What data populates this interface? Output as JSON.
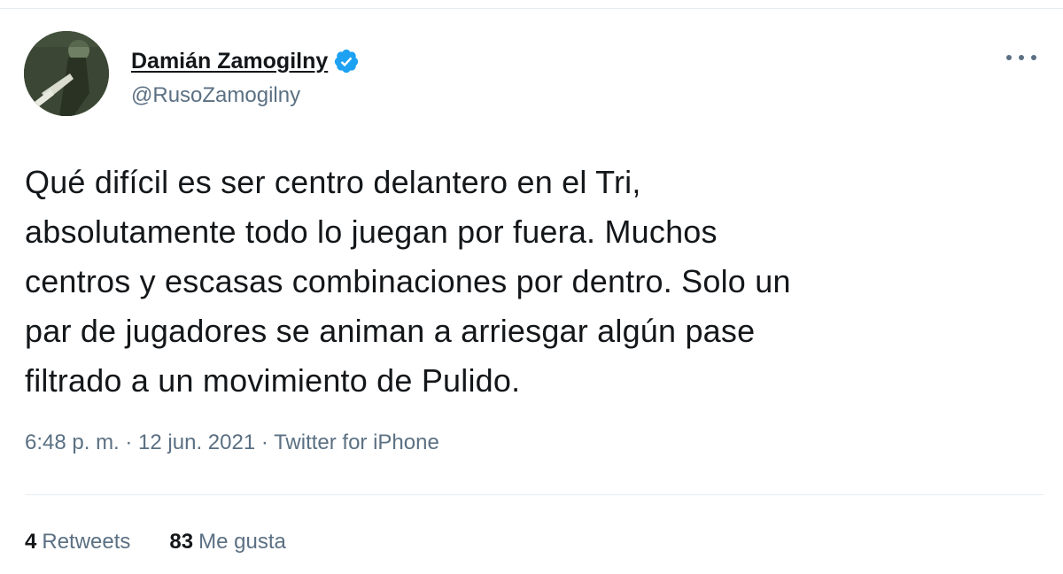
{
  "tweet": {
    "author": {
      "name": "Damián Zamogilny",
      "handle": "@RusoZamogilny",
      "verified": true
    },
    "text": "Qué difícil es ser centro delantero en el Tri,\nabsolutamente todo lo juegan por fuera. Muchos\ncentros y escasas combinaciones por dentro. Solo un\npar de jugadores se animan a arriesgar algún pase\nfiltrado a un movimiento de Pulido.",
    "meta": "6:48 p. m. · 12 jun. 2021 · Twitter for iPhone",
    "retweets_count": "4",
    "retweets_label": "Retweets",
    "likes_count": "83",
    "likes_label": "Me gusta"
  },
  "colors": {
    "verified_blue": "#1da1f2",
    "secondary_text": "#5b7083",
    "primary_text": "#14171a"
  },
  "icons": {
    "verified": "verified-badge-icon",
    "more": "more-options-icon"
  }
}
